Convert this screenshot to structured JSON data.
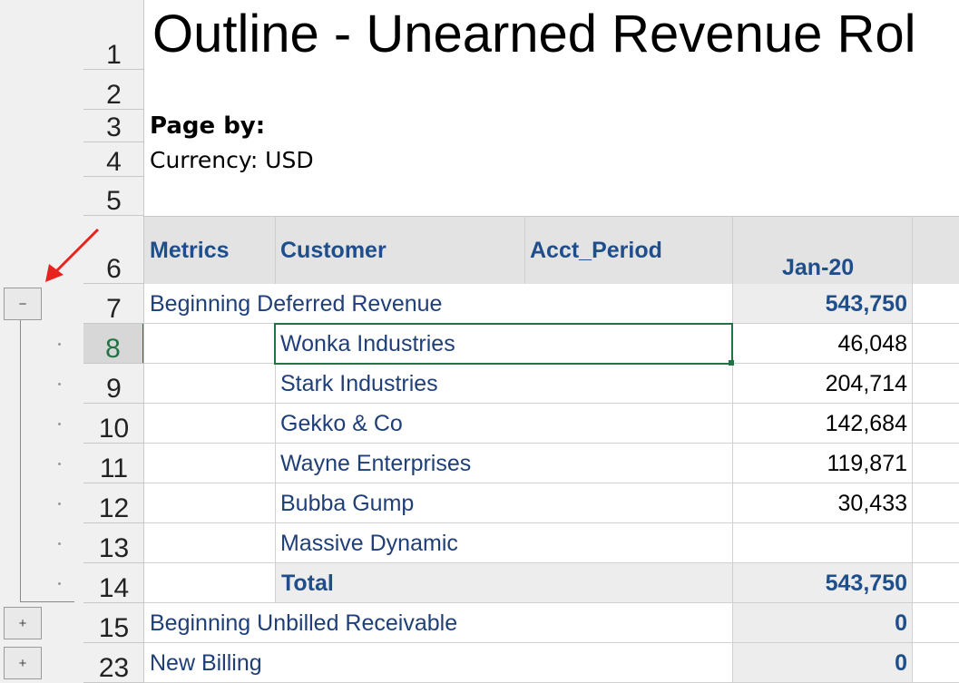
{
  "title": "Outline - Unearned Revenue Rol",
  "page_by_label": "Page by:",
  "currency_label": "Currency: USD",
  "column_headers": {
    "metrics": "Metrics",
    "customer": "Customer",
    "acct_period": "Acct_Period",
    "period": "Jan-20"
  },
  "row_numbers": [
    "1",
    "2",
    "3",
    "4",
    "5",
    "6",
    "7",
    "8",
    "9",
    "10",
    "11",
    "12",
    "13",
    "14",
    "15",
    "23"
  ],
  "outline_buttons": {
    "collapse": "−",
    "expand": "+"
  },
  "rows": {
    "beginning_deferred": {
      "label": "Beginning Deferred Revenue",
      "value": "543,750"
    },
    "customers": [
      {
        "name": "Wonka Industries",
        "value": "46,048"
      },
      {
        "name": "Stark Industries",
        "value": "204,714"
      },
      {
        "name": "Gekko & Co",
        "value": "142,684"
      },
      {
        "name": "Wayne Enterprises",
        "value": "119,871"
      },
      {
        "name": "Bubba Gump",
        "value": "30,433"
      },
      {
        "name": "Massive Dynamic",
        "value": ""
      }
    ],
    "total": {
      "label": "Total",
      "value": "543,750"
    },
    "beginning_unbilled": {
      "label": "Beginning Unbilled Receivable",
      "value": "0"
    },
    "new_billing": {
      "label": "New Billing",
      "value": "0"
    }
  },
  "colors": {
    "header_text": "#1f4e8c",
    "selection": "#217346",
    "annotation_arrow": "#e8231f"
  }
}
